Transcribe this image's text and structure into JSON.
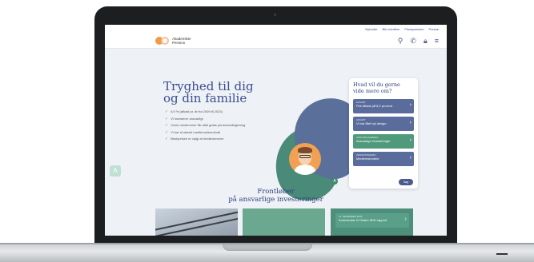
{
  "topbar": {
    "links": [
      "Nyheder",
      "Bliv medlem",
      "Firmapension",
      "Presse"
    ]
  },
  "header": {
    "logo_line1": "Akademiker",
    "logo_line2": "Pension",
    "icons": [
      "search-icon",
      "phone-icon",
      "lock-icon",
      "menu-icon"
    ]
  },
  "hero": {
    "title_line1": "Tryghed til dig",
    "title_line2": "og din familie",
    "bullets": [
      "6,9 % (afkast pr. år fra 2009 til 2023)",
      "Vi investerer ansvarligt",
      "Vores medlemmer får altid gratis pensionsrådgivning",
      "Vi har et stærkt medlemsdemokrati",
      "Bestyrelsen er valgt af medlemmerne"
    ]
  },
  "card": {
    "title_line1": "Hvad vil du gerne",
    "title_line2": "vide mere om?",
    "items": [
      {
        "kicker": "AFKAST",
        "label": "Flot afkast på 8,2 procent",
        "color": "blue"
      },
      {
        "kicker": "AFKAST",
        "label": "Vi har fået nyt design",
        "color": "blue"
      },
      {
        "kicker": "ANSVARLIGHEDEN",
        "label": "Ansvarlige investeringer",
        "color": "green"
      },
      {
        "kicker": "PENSIONSDEMO",
        "label": "Medlemsfordele",
        "color": "blue"
      }
    ],
    "search_label": "Søg"
  },
  "section": {
    "title_line1": "Frontløber",
    "title_line2": "på ansvarlige investeringer"
  },
  "tiles": {
    "news_kicker": "11. DECEMBER 2023",
    "news_label": "Kommentar til Oxfam IBIS-rapport"
  },
  "colors": {
    "brand_blue": "#3b4d8f",
    "brand_green": "#4f9a7c",
    "logo_orange": "#f29a4a"
  }
}
